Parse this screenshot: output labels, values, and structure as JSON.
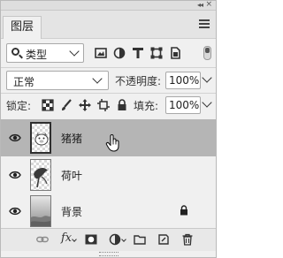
{
  "panel": {
    "tab_label": "图层",
    "collapse_glyph": "◂◂",
    "close_glyph": "×"
  },
  "filter": {
    "kind_label": "类型",
    "icons": [
      "pixel-filter-icon",
      "adjustment-filter-icon",
      "type-filter-icon",
      "shape-filter-icon",
      "smart-object-filter-icon",
      "filter-toggle-switch"
    ]
  },
  "blend": {
    "mode": "正常",
    "opacity_label": "不透明度:",
    "opacity_value": "100%"
  },
  "lock": {
    "label": "锁定:",
    "icons": [
      "lock-transparent-pixels-icon",
      "lock-image-pixels-icon",
      "lock-position-icon",
      "lock-artboard-icon",
      "lock-all-icon"
    ],
    "fill_label": "填充:",
    "fill_value": "100%"
  },
  "layers": [
    {
      "name": "猪猪",
      "visible": true,
      "selected": true,
      "locked": false
    },
    {
      "name": "荷叶",
      "visible": true,
      "selected": false,
      "locked": false
    },
    {
      "name": "背景",
      "visible": true,
      "selected": false,
      "locked": true
    }
  ],
  "bottom_bar": {
    "fx_label": "fx",
    "icons": [
      "link-layers-icon",
      "fx-icon",
      "layer-mask-icon",
      "adjustment-layer-icon",
      "new-group-icon",
      "new-layer-icon",
      "trash-icon"
    ]
  },
  "colors": {
    "selected_row": "#b5b5b5",
    "panel_bg": "#f0f0f0"
  }
}
